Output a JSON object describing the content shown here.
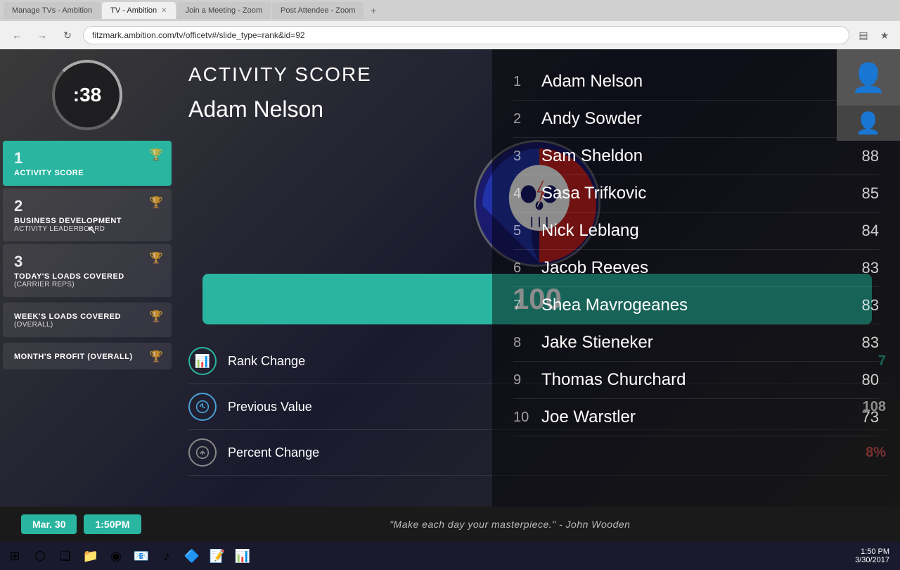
{
  "browser": {
    "tabs": [
      {
        "label": "Manage TVs - Ambition",
        "active": false,
        "id": "tab1"
      },
      {
        "label": "TV - Ambition",
        "active": true,
        "id": "tab2"
      },
      {
        "label": "Join a Meeting - Zoom",
        "active": false,
        "id": "tab3"
      },
      {
        "label": "Post Attendee - Zoom",
        "active": false,
        "id": "tab4"
      }
    ],
    "url": "fitzmark.ambition.com/tv/officetv#/slide_type=rank&id=92",
    "back": "←",
    "forward": "→",
    "refresh": "↻"
  },
  "page": {
    "title": "Activity Score",
    "featured_name": "Adam Nelson",
    "score": "100"
  },
  "timer": {
    "display": ":38"
  },
  "sidebar": {
    "items": [
      {
        "number": "1",
        "title": "Activity Score",
        "subtitle": "",
        "active": true
      },
      {
        "number": "2",
        "title": "Business Development",
        "subtitle": "Activity Leaderboard",
        "active": false
      },
      {
        "number": "3",
        "title": "Today's Loads Covered",
        "subtitle": "(Carrier Reps)",
        "active": false
      },
      {
        "number": "",
        "title": "Week's Loads Covered",
        "subtitle": "(Overall)",
        "active": false
      },
      {
        "number": "",
        "title": "Month's Profit (Overall)",
        "subtitle": "",
        "active": false
      }
    ]
  },
  "stats": [
    {
      "icon": "📊",
      "icon_type": "teal",
      "label": "Rank Change",
      "value": "7",
      "value_color": "teal"
    },
    {
      "icon": "🔄",
      "icon_type": "blue",
      "label": "Previous Value",
      "value": "108",
      "value_color": "white"
    },
    {
      "icon": "📉",
      "icon_type": "gray",
      "label": "Percent Change",
      "value": "8%",
      "value_color": "red"
    }
  ],
  "leaderboard": {
    "rows": [
      {
        "rank": "1",
        "name": "Adam Nelson",
        "score": ""
      },
      {
        "rank": "2",
        "name": "Andy Sowder",
        "score": ""
      },
      {
        "rank": "3",
        "name": "Sam Sheldon",
        "score": "88"
      },
      {
        "rank": "4",
        "name": "Sasa Trifkovic",
        "score": "85"
      },
      {
        "rank": "5",
        "name": "Nick Leblang",
        "score": "84"
      },
      {
        "rank": "6",
        "name": "Jacob Reeves",
        "score": "83"
      },
      {
        "rank": "7",
        "name": "Shea Mavrogeanes",
        "score": "83"
      },
      {
        "rank": "8",
        "name": "Jake Stieneker",
        "score": "83"
      },
      {
        "rank": "9",
        "name": "Thomas Churchard",
        "score": "80"
      },
      {
        "rank": "10",
        "name": "Joe Warstler",
        "score": "73"
      }
    ]
  },
  "bottom_bar": {
    "date": "Mar. 30",
    "time": "1:50PM",
    "quote": "\"Make each day your masterpiece.\" - John Wooden"
  },
  "taskbar": {
    "clock_time": "1:50 PM",
    "clock_date": "3/30/2017"
  }
}
